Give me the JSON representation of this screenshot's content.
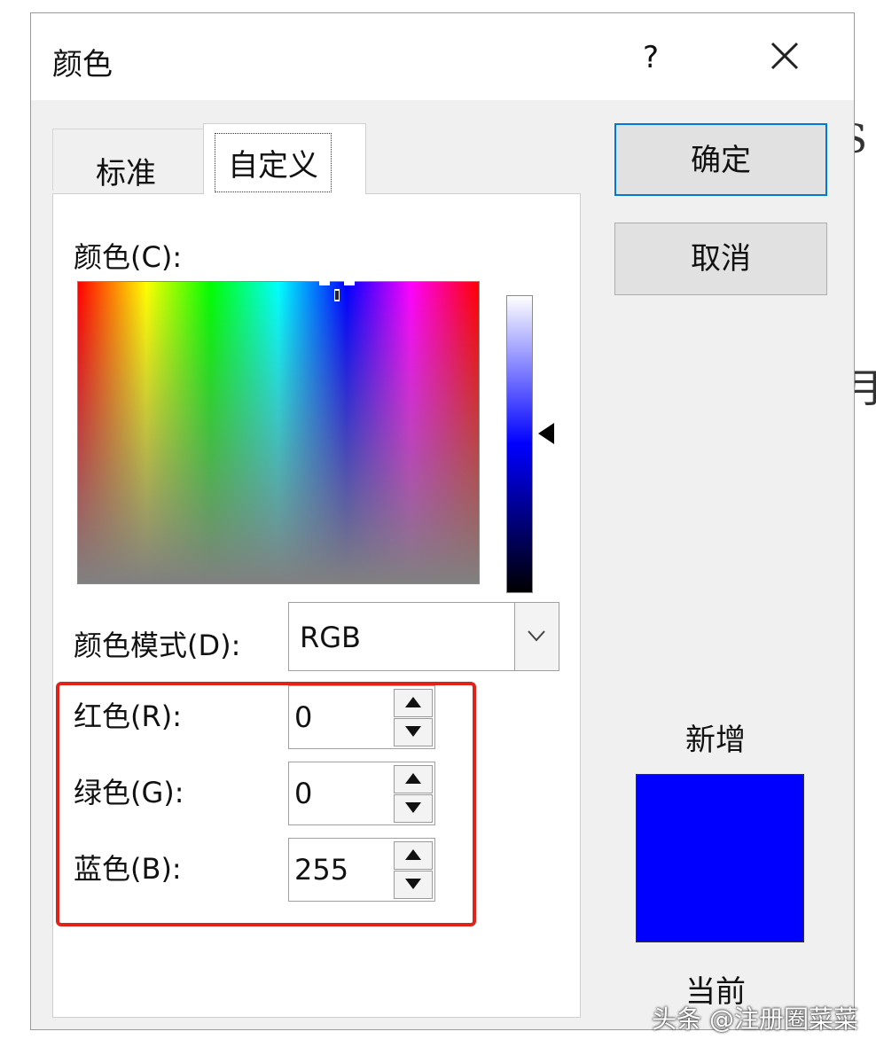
{
  "dialog": {
    "title": "颜色",
    "help": "?",
    "tabs": [
      {
        "label": "标准"
      },
      {
        "label": "自定义"
      }
    ],
    "buttons": {
      "ok": "确定",
      "cancel": "取消"
    }
  },
  "custom": {
    "colors_label": "颜色(C):",
    "mode_label": "颜色模式(D):",
    "mode_value": "RGB",
    "fields": [
      {
        "label": "红色(R):",
        "value": "0"
      },
      {
        "label": "绿色(G):",
        "value": "0"
      },
      {
        "label": "蓝色(B):",
        "value": "255"
      }
    ]
  },
  "preview": {
    "new_label": "新增",
    "current_label": "当前",
    "new_color": "#0000ff"
  },
  "background": {
    "chars": [
      "S",
      "月"
    ]
  },
  "watermark": "头条 @注册圈菜菜"
}
